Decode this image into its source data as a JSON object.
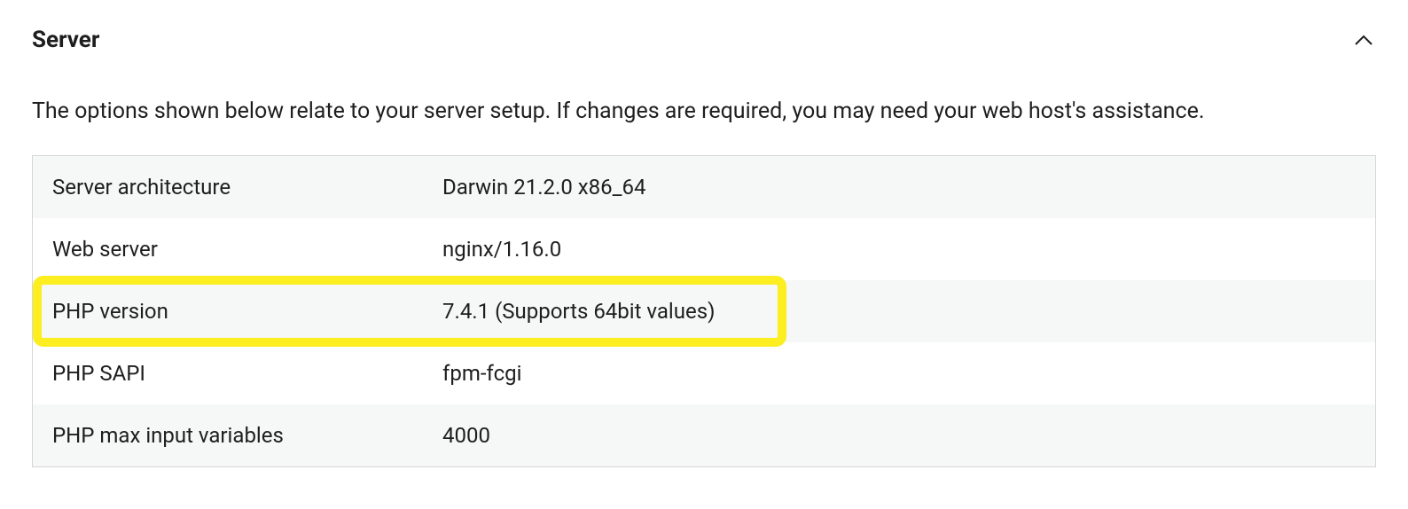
{
  "section": {
    "title": "Server",
    "description": "The options shown below relate to your server setup. If changes are required, you may need your web host's assistance."
  },
  "rows": [
    {
      "label": "Server architecture",
      "value": "Darwin 21.2.0 x86_64"
    },
    {
      "label": "Web server",
      "value": "nginx/1.16.0"
    },
    {
      "label": "PHP version",
      "value": "7.4.1 (Supports 64bit values)"
    },
    {
      "label": "PHP SAPI",
      "value": "fpm-fcgi"
    },
    {
      "label": "PHP max input variables",
      "value": "4000"
    }
  ]
}
